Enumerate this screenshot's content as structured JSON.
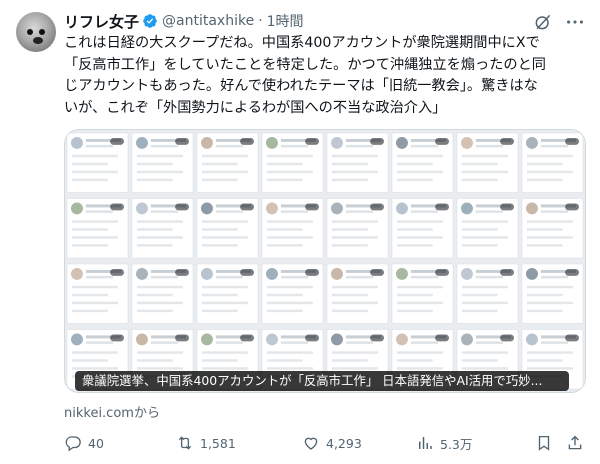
{
  "author": {
    "display_name": "リフレ女子",
    "handle": "@antitaxhike",
    "separator": "·",
    "time": "1時間",
    "avatar_icon": "dog-avatar",
    "verified_icon": "verified-badge-icon"
  },
  "header_icons": [
    "grok-icon",
    "more-icon"
  ],
  "tweet": {
    "lines": [
      "これは日経の大スクープだね。中国系400アカウントが衆院選期間中にXで",
      "「反高市工作」をしていたことを特定した。かつて沖縄独立を煽ったのと同",
      "じアカウントもあった。好んで使われたテーマは「旧統一教会」。驚きはな",
      "いが、これぞ「外国勢力によるわが国への不当な政治介入」"
    ]
  },
  "card": {
    "title": "衆議院選挙、中国系400アカウントが「反高市工作」 日本語発信やAI活用で巧妙...",
    "source": "nikkei.comから",
    "image_icon": "screenshot-grid-of-x-accounts"
  },
  "actions": [
    {
      "name": "reply",
      "icon": "reply-icon",
      "count": "40"
    },
    {
      "name": "repost",
      "icon": "repost-icon",
      "count": "1,581"
    },
    {
      "name": "like",
      "icon": "heart-icon",
      "count": "4,293"
    },
    {
      "name": "views",
      "icon": "views-icon",
      "count": "5.3万"
    },
    {
      "name": "bookmark",
      "icon": "bookmark-icon",
      "count": ""
    },
    {
      "name": "share",
      "icon": "share-icon",
      "count": ""
    }
  ],
  "colors": {
    "text": "#0f1419",
    "secondary": "#536471",
    "verified": "#1d9bf0",
    "border": "#cfd9de"
  }
}
